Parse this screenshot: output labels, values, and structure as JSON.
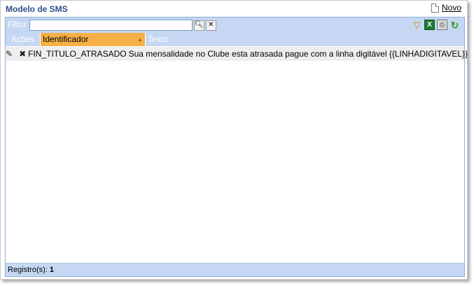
{
  "page": {
    "title": "Modelo de SMS",
    "novo_label": "Novo"
  },
  "toolbar": {
    "filter_label": "Filtro:",
    "filter_value": "",
    "search_icon": "search-icon",
    "clear_icon": "eraser-icon",
    "icons": [
      "filter-icon",
      "excel-icon",
      "print-icon",
      "refresh-icon"
    ]
  },
  "grid": {
    "columns": [
      "Ações",
      "Identificador",
      "Texto"
    ],
    "sorted_column": "Identificador",
    "rows": [
      {
        "identificador": "FIN_TITULO_ATRASADO",
        "texto": "Sua mensalidade no Clube esta atrasada pague com a linha digitável {{LINHADIGITAVEL}}"
      }
    ]
  },
  "footer": {
    "label": "Registro(s):",
    "count": "1"
  },
  "colors": {
    "title": "#2d4f8a",
    "header_bg": "#c5d7f2",
    "sorted_header": "#f5b047",
    "row_bg": "#eeeeee"
  }
}
